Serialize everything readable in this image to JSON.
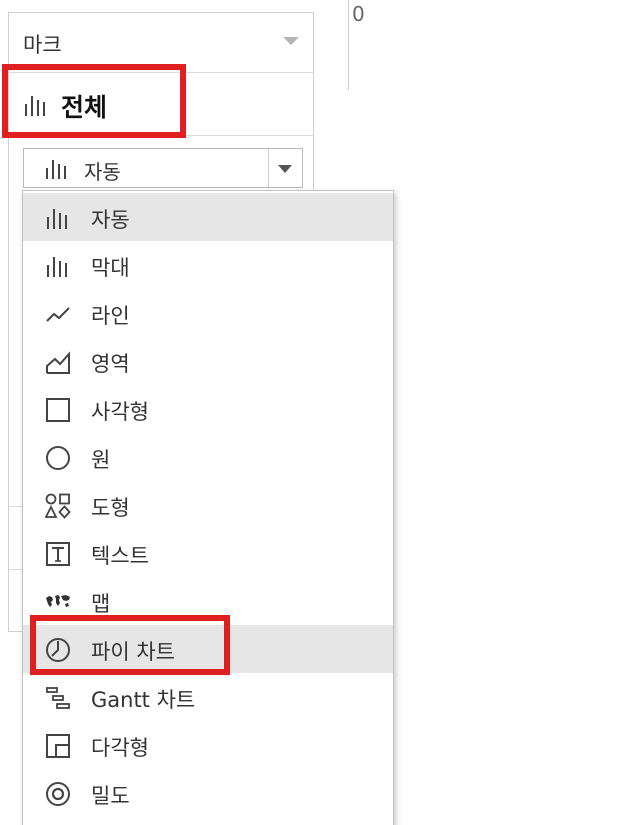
{
  "marks_card": {
    "title": "마크",
    "all_label": "전체",
    "mark_type_selected": "자동"
  },
  "view": {
    "axis_value": "0"
  },
  "dropdown": {
    "items": [
      {
        "label": "자동",
        "icon": "bar-chart-icon",
        "highlighted": true
      },
      {
        "label": "막대",
        "icon": "bar-chart-icon",
        "highlighted": false
      },
      {
        "label": "라인",
        "icon": "line-chart-icon",
        "highlighted": false
      },
      {
        "label": "영역",
        "icon": "area-chart-icon",
        "highlighted": false
      },
      {
        "label": "사각형",
        "icon": "square-icon",
        "highlighted": false
      },
      {
        "label": "원",
        "icon": "circle-icon",
        "highlighted": false
      },
      {
        "label": "도형",
        "icon": "shapes-icon",
        "highlighted": false
      },
      {
        "label": "텍스트",
        "icon": "text-icon",
        "highlighted": false
      },
      {
        "label": "맵",
        "icon": "map-icon",
        "highlighted": false
      },
      {
        "label": "파이 차트",
        "icon": "pie-chart-icon",
        "highlighted": true
      },
      {
        "label": "Gantt 차트",
        "icon": "gantt-icon",
        "highlighted": false
      },
      {
        "label": "다각형",
        "icon": "polygon-icon",
        "highlighted": false
      },
      {
        "label": "밀도",
        "icon": "density-icon",
        "highlighted": false
      }
    ]
  },
  "annotations": {
    "highlight_color": "#e02020"
  }
}
